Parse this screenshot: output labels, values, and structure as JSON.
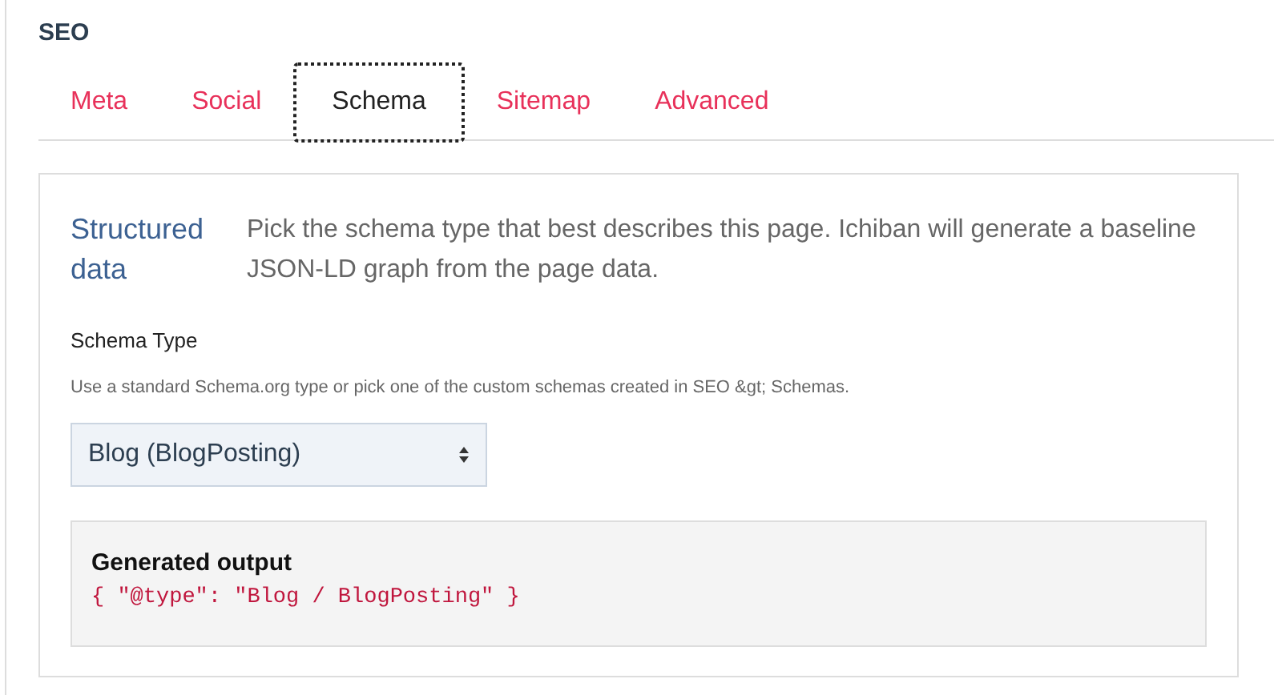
{
  "section_title": "SEO",
  "tabs": [
    {
      "label": "Meta",
      "selected": false
    },
    {
      "label": "Social",
      "selected": false
    },
    {
      "label": "Schema",
      "selected": true
    },
    {
      "label": "Sitemap",
      "selected": false
    },
    {
      "label": "Advanced",
      "selected": false
    }
  ],
  "panel": {
    "heading": "Structured data",
    "description": "Pick the schema type that best describes this page. Ichiban will generate a baseline JSON-LD graph from the page data.",
    "field": {
      "label": "Schema Type",
      "help": "Use a standard Schema.org type or pick one of the custom schemas created in SEO &gt; Schemas.",
      "value": "Blog (BlogPosting)"
    },
    "output": {
      "title": "Generated output",
      "code": "{ \"@type\": \"Blog / BlogPosting\" }"
    }
  }
}
